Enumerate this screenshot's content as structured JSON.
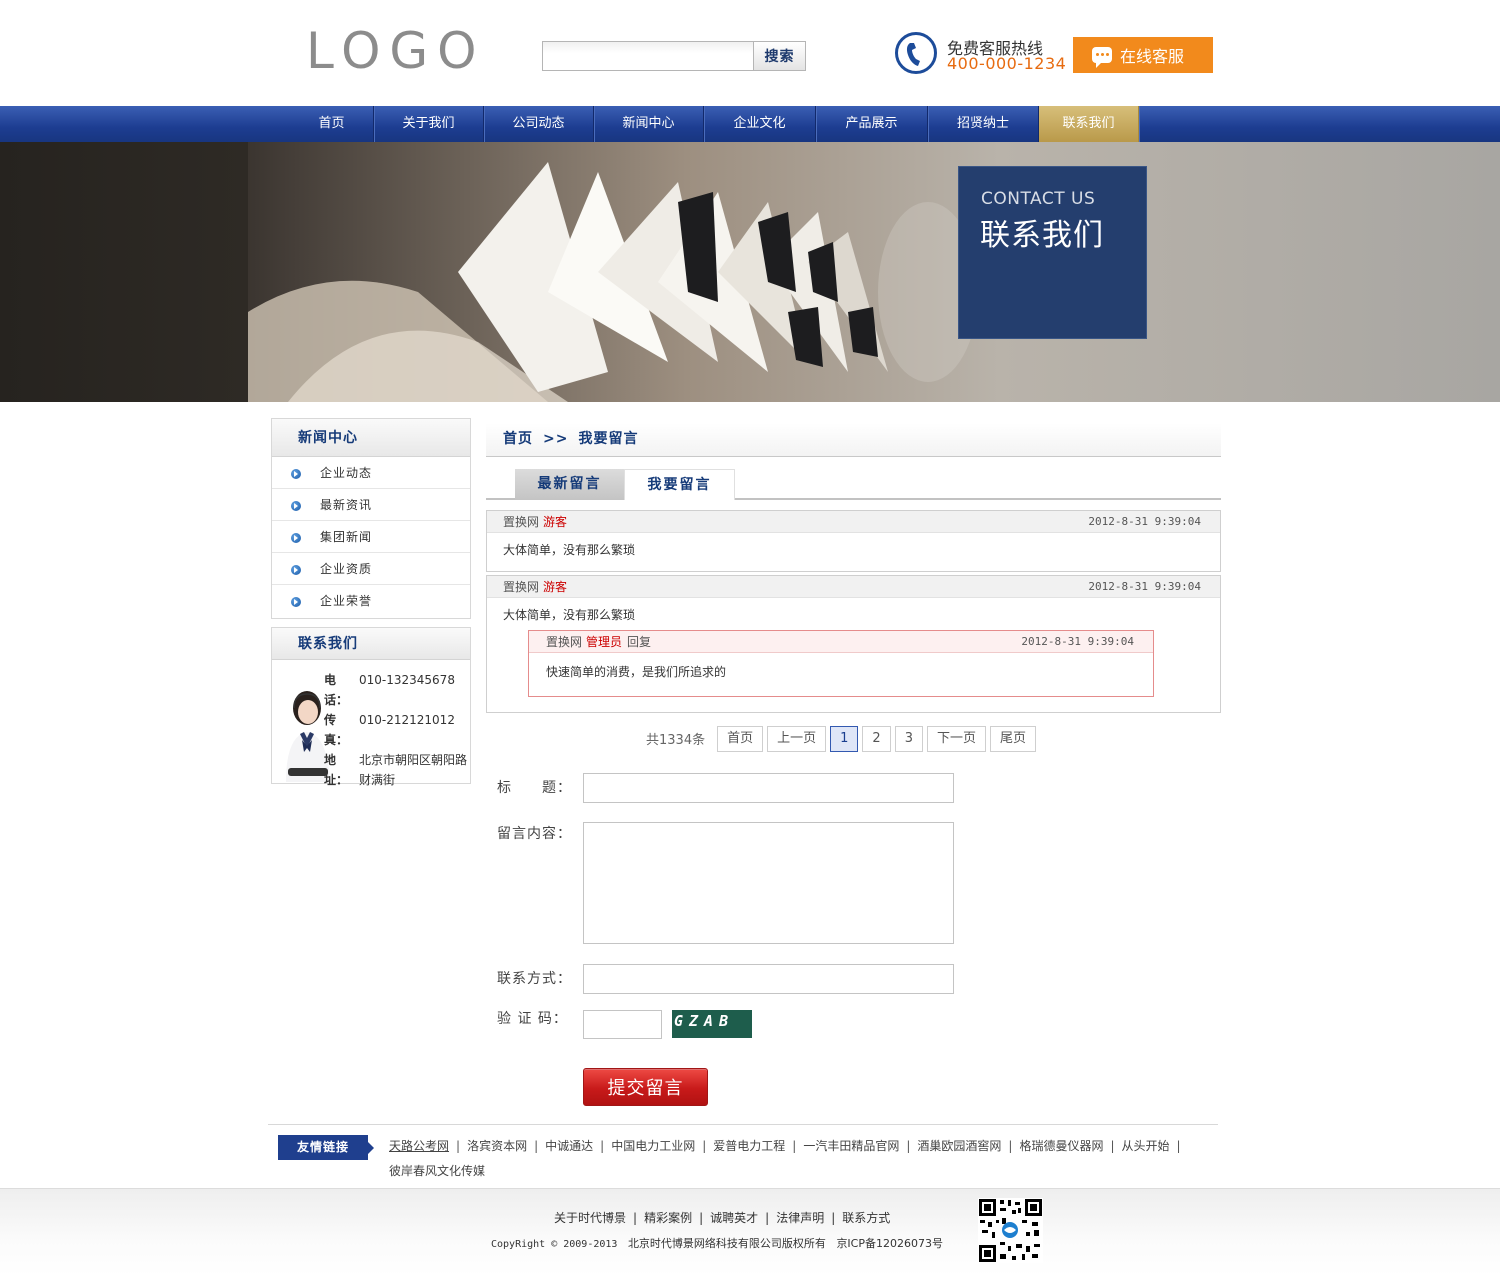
{
  "header": {
    "logo": "LOGO",
    "search_button": "搜索",
    "search_placeholder": "",
    "hotline_label": "免费客服热线",
    "hotline_number": "400-000-1234",
    "online_service": "在线客服"
  },
  "nav": {
    "items": [
      "首页",
      "关于我们",
      "公司动态",
      "新闻中心",
      "企业文化",
      "产品展示",
      "招贤纳士",
      "联系我们"
    ],
    "active_index": 7,
    "active_color": "#c8ad62",
    "bar_color": "#1d3d91"
  },
  "banner": {
    "title_en": "CONTACT US",
    "title_cn": "联系我们"
  },
  "sidebar": {
    "news_title": "新闻中心",
    "news_items": [
      "企业动态",
      "最新资讯",
      "集团新闻",
      "企业资质",
      "企业荣誉"
    ],
    "contact_title": "联系我们",
    "phone_label": "电话：",
    "phone": "010-132345678",
    "fax_label": "传真：",
    "fax": "010-212121012",
    "address_label": "地址：",
    "address": "北京市朝阳区朝阳路财满街"
  },
  "breadcrumb": {
    "home": "首页",
    "sep": ">>",
    "current": "我要留言"
  },
  "tabs": {
    "latest": "最新留言",
    "post": "我要留言"
  },
  "messages": [
    {
      "site": "置换网",
      "user": "游客",
      "time": "2012-8-31  9:39:04",
      "content": "大体简单，没有那么繁琐"
    },
    {
      "site": "置换网",
      "user": "游客",
      "time": "2012-8-31  9:39:04",
      "content": "大体简单，没有那么繁琐",
      "reply": {
        "site": "置换网",
        "user": "管理员",
        "action": "回复",
        "time": "2012-8-31  9:39:04",
        "content": "快速简单的消费，是我们所追求的"
      }
    }
  ],
  "pager": {
    "total": "共1334条",
    "first": "首页",
    "prev": "上一页",
    "pages": [
      "1",
      "2",
      "3"
    ],
    "current": "1",
    "next": "下一页",
    "last": "尾页"
  },
  "form": {
    "title_label": "标　　题：",
    "content_label": "留言内容：",
    "contact_label": "联系方式：",
    "captcha_label": "验 证 码：",
    "captcha_text": "GZAB",
    "submit": "提交留言"
  },
  "friend_links": {
    "label": "友情链接",
    "items": [
      "天路公考网",
      "洛宾资本网",
      "中诚通达",
      "中国电力工业网",
      "爱普电力工程",
      "一汽丰田精品官网",
      "酒巢欧园酒窖网",
      "格瑞德曼仪器网",
      "从头开始",
      "彼岸春风文化传媒"
    ]
  },
  "footer": {
    "links": [
      "关于时代博景",
      "精彩案例",
      "诚聘英才",
      "法律声明",
      "联系方式"
    ],
    "copyright_en": "CopyRight © 2009-2013",
    "company": "北京时代博景网络科技有限公司版权所有",
    "icp": "京ICP备12026073号"
  }
}
